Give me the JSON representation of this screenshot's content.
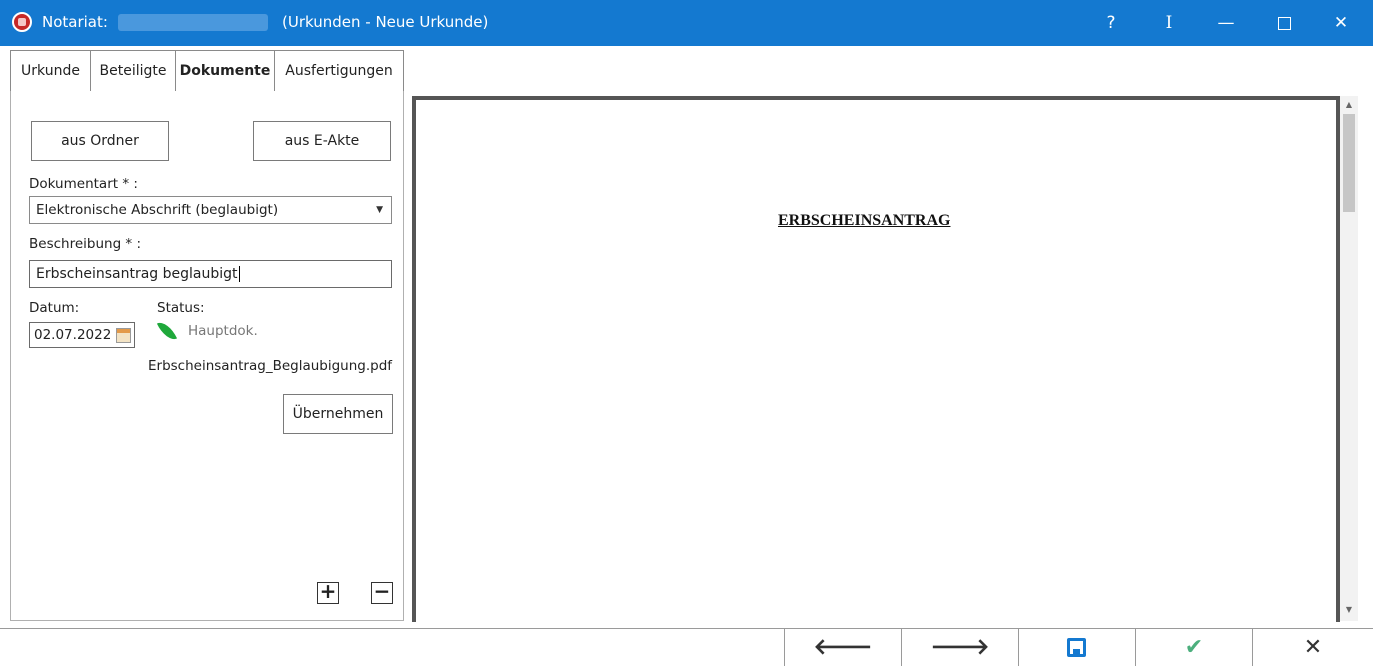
{
  "window": {
    "app_name": "Notariat:",
    "context": "(Urkunden - Neue Urkunde)",
    "controls": {
      "help": "?",
      "info": "I",
      "minimize": "—",
      "close": "✕"
    }
  },
  "tabs": [
    {
      "label": "Urkunde"
    },
    {
      "label": "Beteiligte"
    },
    {
      "label": "Dokumente",
      "active": true
    },
    {
      "label": "Ausfertigungen"
    }
  ],
  "form": {
    "btn_from_folder": "aus Ordner",
    "btn_from_eakte": "aus E-Akte",
    "doc_type_label": "Dokumentart * :",
    "doc_type_value": "Elektronische Abschrift (beglaubigt)",
    "description_label": "Beschreibung * :",
    "description_value": "Erbscheinsantrag beglaubigt",
    "date_label": "Datum:",
    "date_value": "02.07.2022",
    "status_label": "Status:",
    "status_value": "Hauptdok.",
    "file_name": "Erbscheinsantrag_Beglaubigung.pdf",
    "apply_button": "Übernehmen",
    "add_button": "+",
    "remove_button": "−"
  },
  "preview": {
    "heading": "ERBSCHEINSANTRAG"
  },
  "bottom_bar": {
    "prev": "🡐",
    "next": "🡒",
    "ok": "✔",
    "cancel": "✕"
  },
  "colors": {
    "titlebar": "#1479d0",
    "ok": "#4caf7d",
    "leaf": "#1fa83b"
  }
}
